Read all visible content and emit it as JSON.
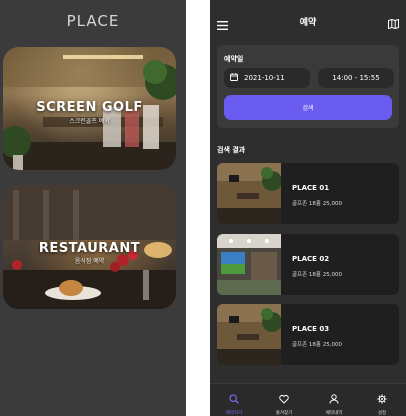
{
  "left_screen": {
    "title": "PLACE",
    "cards": [
      {
        "title": "SCREEN GOLF",
        "subtitle": "스크린골프 예약"
      },
      {
        "title": "RESTAURANT",
        "subtitle": "음식점 예약"
      }
    ]
  },
  "right_screen": {
    "header": {
      "title": "예약",
      "menu_icon": "hamburger-icon",
      "map_icon": "map-icon"
    },
    "date_section": {
      "label": "예약일",
      "date": "2021-10-11",
      "time": "14:00 - 15:55",
      "search_label": "검색",
      "accent": "#6b5cf0"
    },
    "results_label": "검색 결과",
    "results": [
      {
        "name": "PLACE 01",
        "info": "골프존 18홀 25,000"
      },
      {
        "name": "PLACE 02",
        "info": "골프존 18홀 25,000"
      },
      {
        "name": "PLACE 03",
        "info": "골프존 18홀 25,000"
      }
    ],
    "nav": [
      {
        "label": "예약하기",
        "icon": "search-icon",
        "active": true
      },
      {
        "label": "즐겨찾기",
        "icon": "heart-icon",
        "active": false
      },
      {
        "label": "예약내역",
        "icon": "user-icon",
        "active": false
      },
      {
        "label": "설정",
        "icon": "gear-icon",
        "active": false
      }
    ]
  }
}
